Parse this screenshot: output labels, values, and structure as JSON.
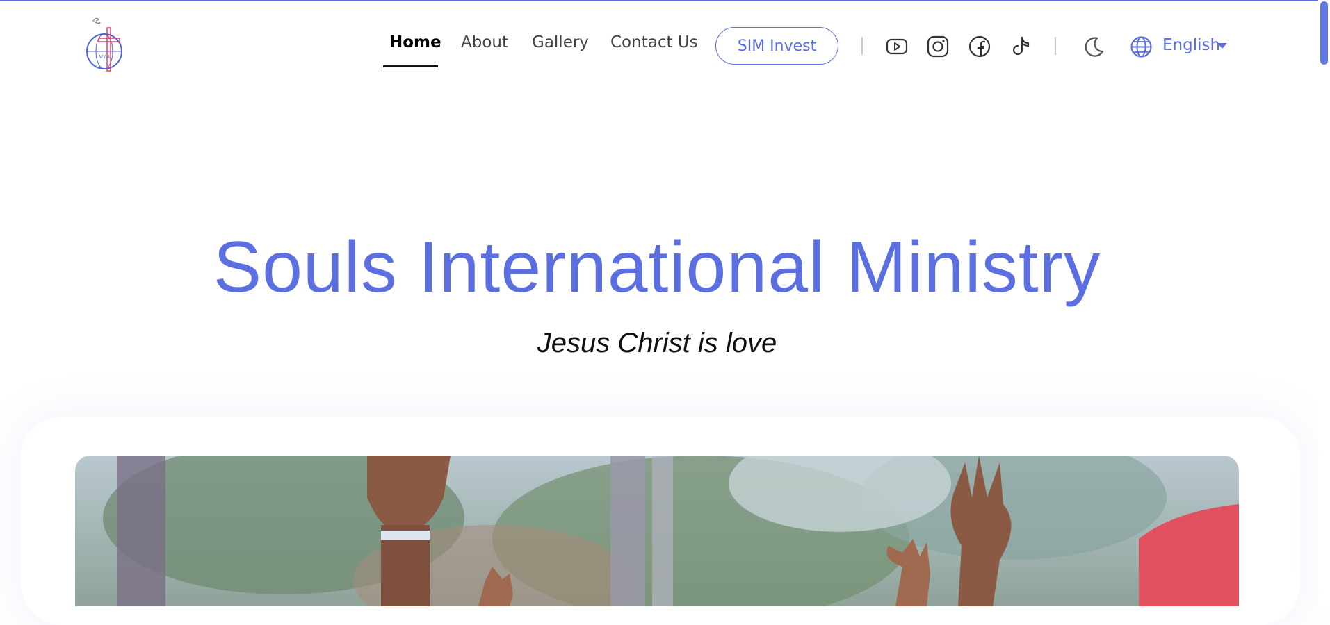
{
  "nav": {
    "home": "Home",
    "about": "About",
    "gallery": "Gallery",
    "contact": "Contact Us",
    "invest_button": "SIM Invest"
  },
  "social_icons": [
    "youtube-icon",
    "instagram-icon",
    "facebook-icon",
    "tiktok-icon"
  ],
  "theme_icon": "moon-icon",
  "language": {
    "icon": "globe-icon",
    "selected": "English"
  },
  "hero": {
    "title": "Souls International Ministry",
    "subtitle": "Jesus Christ is love"
  },
  "colors": {
    "accent": "#5b6fe0",
    "text": "#111111",
    "nav_text": "#444444"
  }
}
